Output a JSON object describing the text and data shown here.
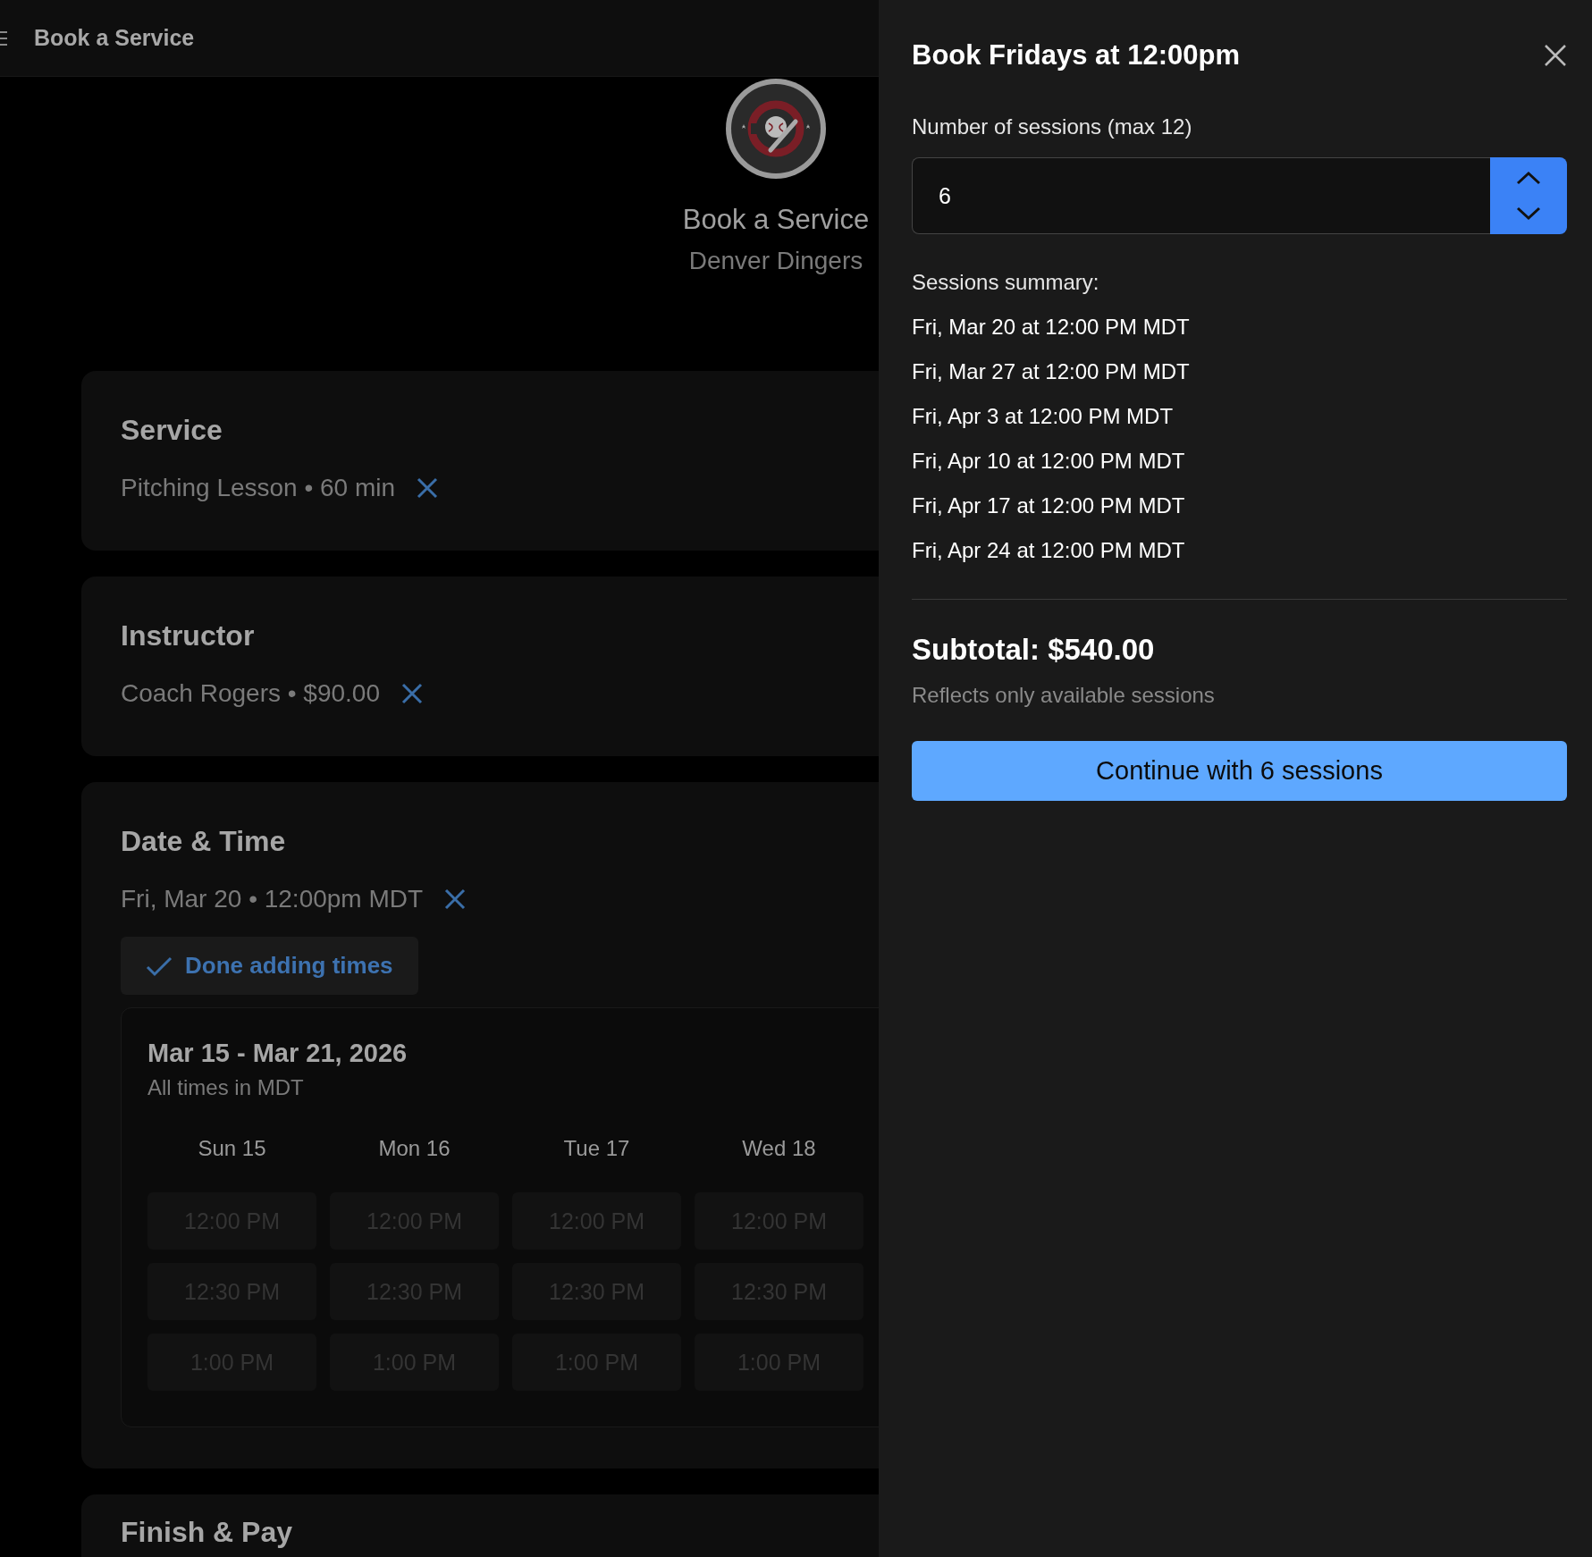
{
  "header": {
    "title": "Book a Service"
  },
  "hero": {
    "title": "Book a Service",
    "subtitle": "Denver Dingers"
  },
  "sections": [
    {
      "kind": "summary",
      "title": "Service",
      "value": "Pitching Lesson • 60 min"
    },
    {
      "kind": "summary",
      "title": "Instructor",
      "value": "Coach Rogers • $90.00"
    },
    {
      "kind": "datetime",
      "title": "Date & Time",
      "value": "Fri, Mar 20 • 12:00pm MDT",
      "done_button": "Done adding times",
      "calendar": {
        "range": "Mar 15 - Mar 21, 2026",
        "timezone_note": "All times in MDT",
        "days": [
          {
            "label": "Sun 15",
            "slots": [
              {
                "time": "12:00 PM",
                "disabled": true
              },
              {
                "time": "12:30 PM",
                "disabled": true
              },
              {
                "time": "1:00 PM",
                "disabled": true
              }
            ]
          },
          {
            "label": "Mon 16",
            "slots": [
              {
                "time": "12:00 PM",
                "disabled": true
              },
              {
                "time": "12:30 PM",
                "disabled": true
              },
              {
                "time": "1:00 PM",
                "disabled": true
              }
            ]
          },
          {
            "label": "Tue 17",
            "slots": [
              {
                "time": "12:00 PM",
                "disabled": true
              },
              {
                "time": "12:30 PM",
                "disabled": true
              },
              {
                "time": "1:00 PM",
                "disabled": true
              }
            ]
          },
          {
            "label": "Wed 18",
            "slots": [
              {
                "time": "12:00 PM",
                "disabled": true
              },
              {
                "time": "12:30 PM",
                "disabled": true
              },
              {
                "time": "1:00 PM",
                "disabled": true
              }
            ]
          }
        ]
      }
    },
    {
      "kind": "title_only",
      "title": "Finish & Pay"
    }
  ],
  "drawer": {
    "title": "Book Fridays at 12:00pm",
    "sessions_label": "Number of sessions (max 12)",
    "sessions_value": "6",
    "summary_label": "Sessions summary:",
    "sessions": [
      "Fri, Mar 20 at 12:00 PM MDT",
      "Fri, Mar 27 at 12:00 PM MDT",
      "Fri, Apr 3 at 12:00 PM MDT",
      "Fri, Apr 10 at 12:00 PM MDT",
      "Fri, Apr 17 at 12:00 PM MDT",
      "Fri, Apr 24 at 12:00 PM MDT"
    ],
    "subtotal": "Subtotal: $540.00",
    "note": "Reflects only available sessions",
    "button": "Continue with 6 sessions"
  }
}
